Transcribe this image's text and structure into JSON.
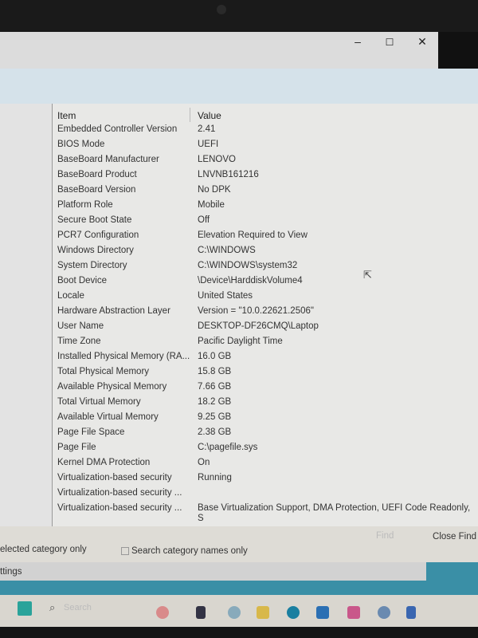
{
  "window": {
    "minimize_icon": "minimize-icon",
    "maximize_icon": "maximize-icon",
    "close_icon": "close-icon",
    "minimize": "–",
    "maximize": "☐",
    "close": "✕"
  },
  "table": {
    "headers": {
      "item": "Item",
      "value": "Value"
    },
    "rows": [
      {
        "item": "Embedded Controller Version",
        "value": "2.41"
      },
      {
        "item": "BIOS Mode",
        "value": "UEFI"
      },
      {
        "item": "BaseBoard Manufacturer",
        "value": "LENOVO"
      },
      {
        "item": "BaseBoard Product",
        "value": "LNVNB161216"
      },
      {
        "item": "BaseBoard Version",
        "value": "No DPK"
      },
      {
        "item": "Platform Role",
        "value": "Mobile"
      },
      {
        "item": "Secure Boot State",
        "value": "Off"
      },
      {
        "item": "PCR7 Configuration",
        "value": "Elevation Required to View"
      },
      {
        "item": "Windows Directory",
        "value": "C:\\WINDOWS"
      },
      {
        "item": "System Directory",
        "value": "C:\\WINDOWS\\system32"
      },
      {
        "item": "Boot Device",
        "value": "\\Device\\HarddiskVolume4"
      },
      {
        "item": "Locale",
        "value": "United States"
      },
      {
        "item": "Hardware Abstraction Layer",
        "value": "Version = \"10.0.22621.2506\""
      },
      {
        "item": "User Name",
        "value": "DESKTOP-DF26CMQ\\Laptop"
      },
      {
        "item": "Time Zone",
        "value": "Pacific Daylight Time"
      },
      {
        "item": "Installed Physical Memory (RA...",
        "value": "16.0 GB"
      },
      {
        "item": "Total Physical Memory",
        "value": "15.8 GB"
      },
      {
        "item": "Available Physical Memory",
        "value": "7.66 GB"
      },
      {
        "item": "Total Virtual Memory",
        "value": "18.2 GB"
      },
      {
        "item": "Available Virtual Memory",
        "value": "9.25 GB"
      },
      {
        "item": "Page File Space",
        "value": "2.38 GB"
      },
      {
        "item": "Page File",
        "value": "C:\\pagefile.sys"
      },
      {
        "item": "Kernel DMA Protection",
        "value": "On"
      },
      {
        "item": "Virtualization-based security",
        "value": "Running"
      },
      {
        "item": "Virtualization-based security ...",
        "value": ""
      },
      {
        "item": "Virtualization-based security ...",
        "value": "Base Virtualization Support, DMA Protection, UEFI Code Readonly, S"
      }
    ]
  },
  "find": {
    "find_label": "Find",
    "close_find": "Close Find",
    "selected_only": "elected category only",
    "names_only": "Search category names only"
  },
  "settings_label": "ttings",
  "taskbar": {
    "search_placeholder": "Search"
  }
}
